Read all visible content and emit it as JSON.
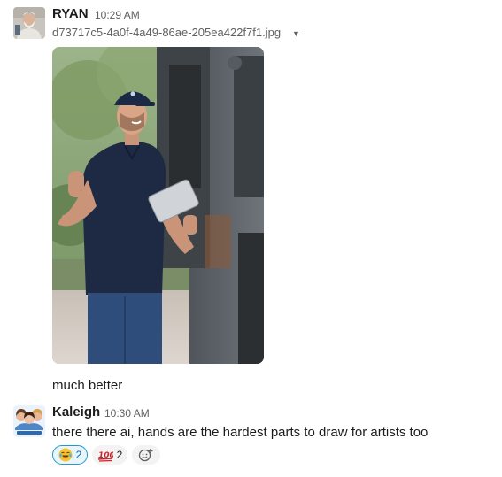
{
  "messages": [
    {
      "author": "RYAN",
      "time": "10:29 AM",
      "attachment": {
        "filename": "d73717c5-4a0f-4a49-86ae-205ea422f7f1.jpg",
        "caret": "▼"
      },
      "text": "much better"
    },
    {
      "author": "Kaleigh",
      "time": "10:30 AM",
      "text": "there there ai, hands are the hardest parts to draw for artists too",
      "reactions": [
        {
          "emoji": "joy",
          "count": "2"
        },
        {
          "emoji": "100",
          "count": "2"
        }
      ]
    }
  ],
  "colors": {
    "accent": "#1d9bd1",
    "text": "#1d1c1d",
    "muted": "#616061"
  }
}
